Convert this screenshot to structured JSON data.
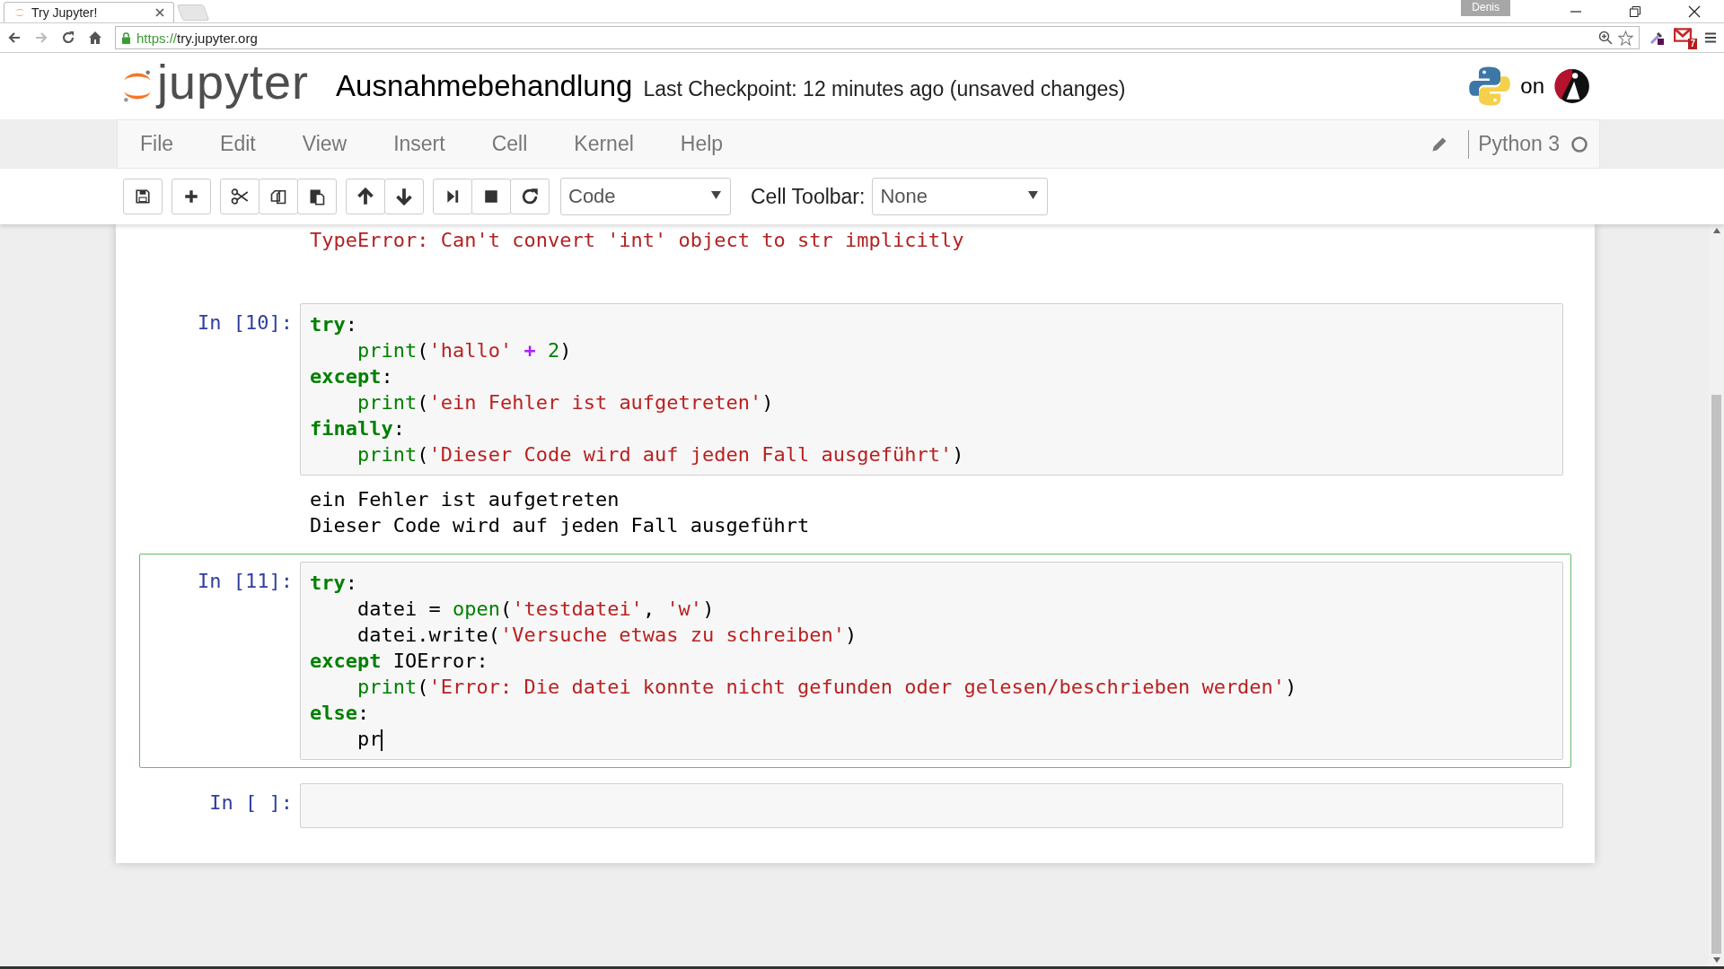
{
  "browser": {
    "tab_title": "Try Jupyter!",
    "url_scheme": "https://",
    "url_host": "try.jupyter.org",
    "profile": "Denis",
    "mail_count": "7"
  },
  "header": {
    "logo_text": "jupyter",
    "notebook_name": "Ausnahmebehandlung",
    "checkpoint": "Last Checkpoint: 12 minutes ago (unsaved changes)",
    "on_text": "on"
  },
  "menu": [
    "File",
    "Edit",
    "View",
    "Insert",
    "Cell",
    "Kernel",
    "Help"
  ],
  "kernel": {
    "name": "Python 3",
    "busy": false
  },
  "toolbar": {
    "cell_type": "Code",
    "cell_toolbar_label": "Cell Toolbar:",
    "cell_toolbar_value": "None"
  },
  "cells": [
    {
      "selected": false,
      "outputs": [
        {
          "kind": "error",
          "text": "TypeError: Can't convert 'int' object to str implicitly"
        }
      ]
    },
    {
      "prompt": "In [10]:",
      "selected": false,
      "code": [
        {
          "indent": false,
          "tokens": [
            {
              "kind": "kw",
              "text": "try"
            },
            {
              "kind": "plain",
              "text": ":"
            }
          ]
        },
        {
          "indent": true,
          "tokens": [
            {
              "kind": "builtin",
              "text": "print"
            },
            {
              "kind": "plain",
              "text": "("
            },
            {
              "kind": "str",
              "text": "'hallo'"
            },
            {
              "kind": "op",
              "text": " + "
            },
            {
              "kind": "num",
              "text": "2"
            },
            {
              "kind": "plain",
              "text": ")"
            }
          ]
        },
        {
          "indent": false,
          "tokens": [
            {
              "kind": "kw",
              "text": "except"
            },
            {
              "kind": "plain",
              "text": ":"
            }
          ]
        },
        {
          "indent": true,
          "tokens": [
            {
              "kind": "builtin",
              "text": "print"
            },
            {
              "kind": "plain",
              "text": "("
            },
            {
              "kind": "str",
              "text": "'ein Fehler ist aufgetreten'"
            },
            {
              "kind": "plain",
              "text": ")"
            }
          ]
        },
        {
          "indent": false,
          "tokens": [
            {
              "kind": "kw",
              "text": "finally"
            },
            {
              "kind": "plain",
              "text": ":"
            }
          ]
        },
        {
          "indent": true,
          "tokens": [
            {
              "kind": "builtin",
              "text": "print"
            },
            {
              "kind": "plain",
              "text": "("
            },
            {
              "kind": "str",
              "text": "'Dieser Code wird auf jeden Fall ausgeführt'"
            },
            {
              "kind": "plain",
              "text": ")"
            }
          ]
        }
      ],
      "outputs": [
        {
          "kind": "stream",
          "text": "ein Fehler ist aufgetreten"
        },
        {
          "kind": "stream",
          "text": "Dieser Code wird auf jeden Fall ausgeführt"
        }
      ]
    },
    {
      "prompt": "In [11]:",
      "selected": true,
      "code": [
        {
          "indent": false,
          "tokens": [
            {
              "kind": "kw",
              "text": "try"
            },
            {
              "kind": "plain",
              "text": ":"
            }
          ]
        },
        {
          "indent": true,
          "tokens": [
            {
              "kind": "plain",
              "text": "datei = "
            },
            {
              "kind": "builtin",
              "text": "open"
            },
            {
              "kind": "plain",
              "text": "("
            },
            {
              "kind": "str",
              "text": "'testdatei'"
            },
            {
              "kind": "plain",
              "text": ", "
            },
            {
              "kind": "str",
              "text": "'w'"
            },
            {
              "kind": "plain",
              "text": ")"
            }
          ]
        },
        {
          "indent": true,
          "tokens": [
            {
              "kind": "plain",
              "text": "datei.write("
            },
            {
              "kind": "str",
              "text": "'Versuche etwas zu schreiben'"
            },
            {
              "kind": "plain",
              "text": ")"
            }
          ]
        },
        {
          "indent": false,
          "tokens": [
            {
              "kind": "kw",
              "text": "except"
            },
            {
              "kind": "plain",
              "text": " IOError:"
            }
          ]
        },
        {
          "indent": true,
          "tokens": [
            {
              "kind": "builtin",
              "text": "print"
            },
            {
              "kind": "plain",
              "text": "("
            },
            {
              "kind": "str",
              "text": "'Error: Die datei konnte nicht gefunden oder gelesen/beschrieben werden'"
            },
            {
              "kind": "plain",
              "text": ")"
            }
          ]
        },
        {
          "indent": false,
          "tokens": [
            {
              "kind": "kw",
              "text": "else"
            },
            {
              "kind": "plain",
              "text": ":"
            }
          ]
        },
        {
          "indent": true,
          "tokens": [
            {
              "kind": "plain",
              "text": "pr"
            }
          ]
        }
      ]
    },
    {
      "prompt": "In [ ]:",
      "selected": false
    }
  ]
}
